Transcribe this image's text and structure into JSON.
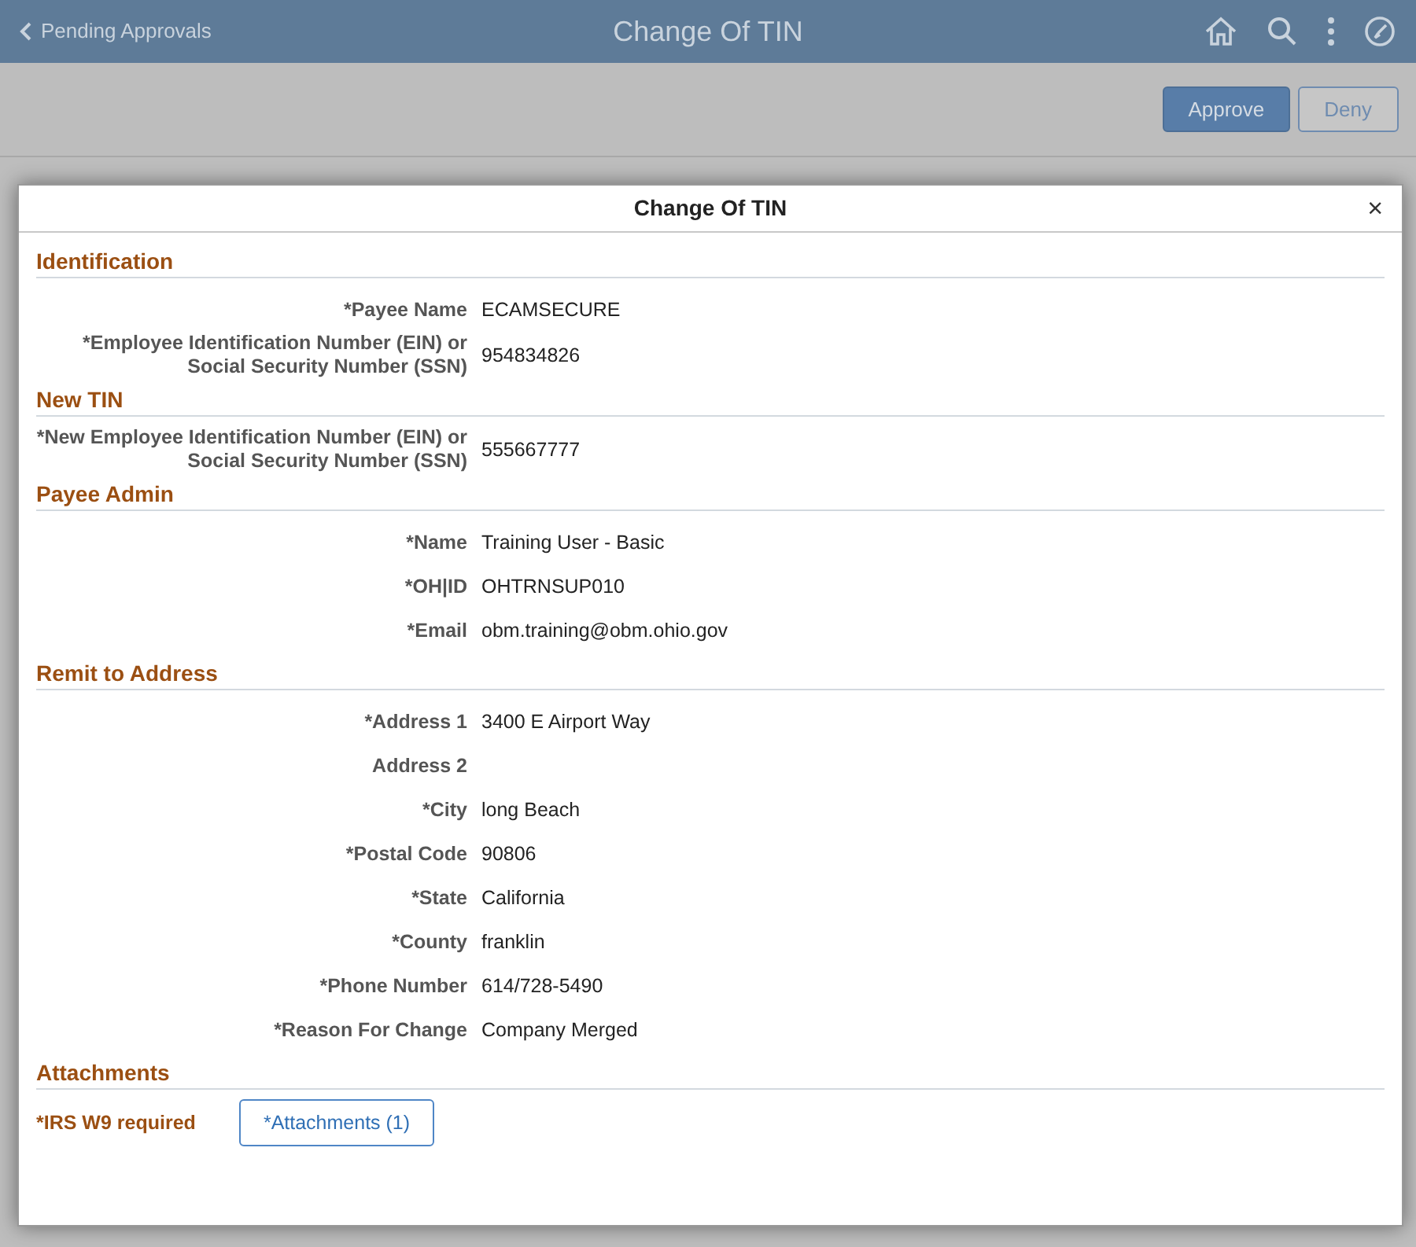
{
  "header": {
    "back_link": "Pending Approvals",
    "title": "Change Of TIN"
  },
  "actions": [
    {
      "label": "Approve",
      "kind": "primary"
    },
    {
      "label": "Deny",
      "kind": "secondary"
    }
  ],
  "modal": {
    "title": "Change Of TIN",
    "close": "×",
    "sections": [
      {
        "title": "Identification",
        "fields": [
          {
            "label": "*Payee Name",
            "value": "ECAMSECURE"
          },
          {
            "label": "*Employee Identification Number (EIN) or Social Security Number (SSN)",
            "value": "954834826"
          }
        ]
      },
      {
        "title": "New TIN",
        "fields": [
          {
            "label": "*New Employee Identification Number (EIN) or Social Security Number (SSN)",
            "value": "555667777"
          }
        ]
      },
      {
        "title": "Payee Admin",
        "fields": [
          {
            "label": "*Name",
            "value": "Training User - Basic"
          },
          {
            "label": "*OH|ID",
            "value": "OHTRNSUP010"
          },
          {
            "label": "*Email",
            "value": "obm.training@obm.ohio.gov"
          }
        ]
      },
      {
        "title": "Remit to Address",
        "fields": [
          {
            "label": "*Address 1",
            "value": "3400 E Airport Way"
          },
          {
            "label": "Address 2"
          },
          {
            "label": "*City",
            "value": "long Beach"
          },
          {
            "label": "*Postal Code",
            "value": "90806"
          },
          {
            "label": "*State",
            "value": "California"
          },
          {
            "label": "*County",
            "value": "franklin"
          },
          {
            "label": "*Phone Number",
            "value": "614/728-5490"
          },
          {
            "label": "*Reason For Change",
            "value": "Company Merged"
          }
        ]
      },
      {
        "title": "Attachments",
        "attachment": {
          "note": "*IRS W9 required",
          "button": "*Attachments (1)"
        }
      }
    ]
  }
}
